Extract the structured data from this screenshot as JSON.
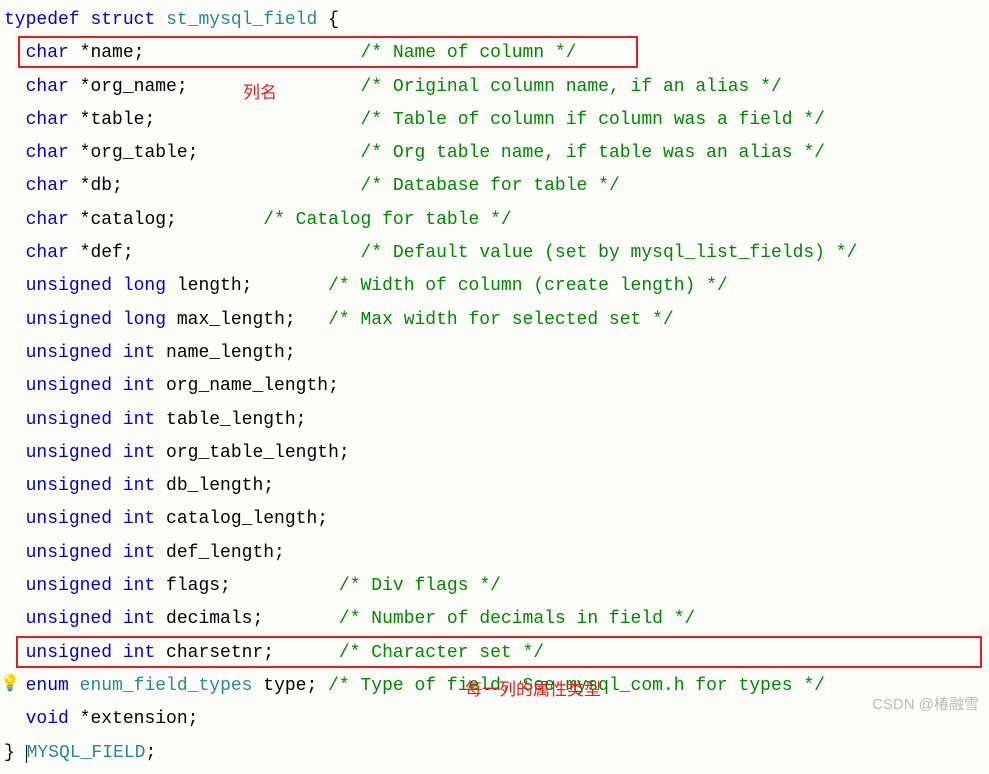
{
  "code": {
    "l1_kw1": "typedef",
    "l1_kw2": "struct",
    "l1_type": "st_mysql_field",
    "l1_brace": " {",
    "l2_kw": "char",
    "l2_id": "*name;",
    "l2_c": "/* Name of column */",
    "l3_kw": "char",
    "l3_id": "*org_name;",
    "l3_c": "/* Original column name, if an alias */",
    "l4_kw": "char",
    "l4_id": "*table;",
    "l4_c": "/* Table of column if column was a field */",
    "l5_kw": "char",
    "l5_id": "*org_table;",
    "l5_c": "/* Org table name, if table was an alias */",
    "l6_kw": "char",
    "l6_id": "*db;",
    "l6_c": "/* Database for table */",
    "l7_kw": "char",
    "l7_id": "*catalog;",
    "l7_c": "/* Catalog for table */",
    "l8_kw": "char",
    "l8_id": "*def;",
    "l8_c": "/* Default value (set by mysql_list_fields) */",
    "l9_kw": "unsigned long",
    "l9_id": " length;",
    "l9_c": "/* Width of column (create length) */",
    "l10_kw": "unsigned long",
    "l10_id": " max_length;",
    "l10_c": "/* Max width for selected set */",
    "l11_kw": "unsigned int",
    "l11_id": " name_length;",
    "l12_kw": "unsigned int",
    "l12_id": " org_name_length;",
    "l13_kw": "unsigned int",
    "l13_id": " table_length;",
    "l14_kw": "unsigned int",
    "l14_id": " org_table_length;",
    "l15_kw": "unsigned int",
    "l15_id": " db_length;",
    "l16_kw": "unsigned int",
    "l16_id": " catalog_length;",
    "l17_kw": "unsigned int",
    "l17_id": " def_length;",
    "l18_kw": "unsigned int",
    "l18_id": " flags;",
    "l18_c": "/* Div flags */",
    "l19_kw": "unsigned int",
    "l19_id": " decimals;",
    "l19_c": "/* Number of decimals in field */",
    "l20_kw": "unsigned int",
    "l20_id": " charsetnr;",
    "l20_c": "/* Character set */",
    "l21_kw": "enum",
    "l21_type": "enum_field_types",
    "l21_id": " type;",
    "l21_c": "/* Type of field. See mysql_com.h for types */",
    "l22_kw": "void",
    "l22_id": "*extension;",
    "l23_brace": "} ",
    "l23_type": "MYSQL_FIELD",
    "l23_semi": ";"
  },
  "annotations": {
    "a1": "列名",
    "a2": "每一列的属性类型"
  },
  "watermark": "CSDN @椿融雪"
}
